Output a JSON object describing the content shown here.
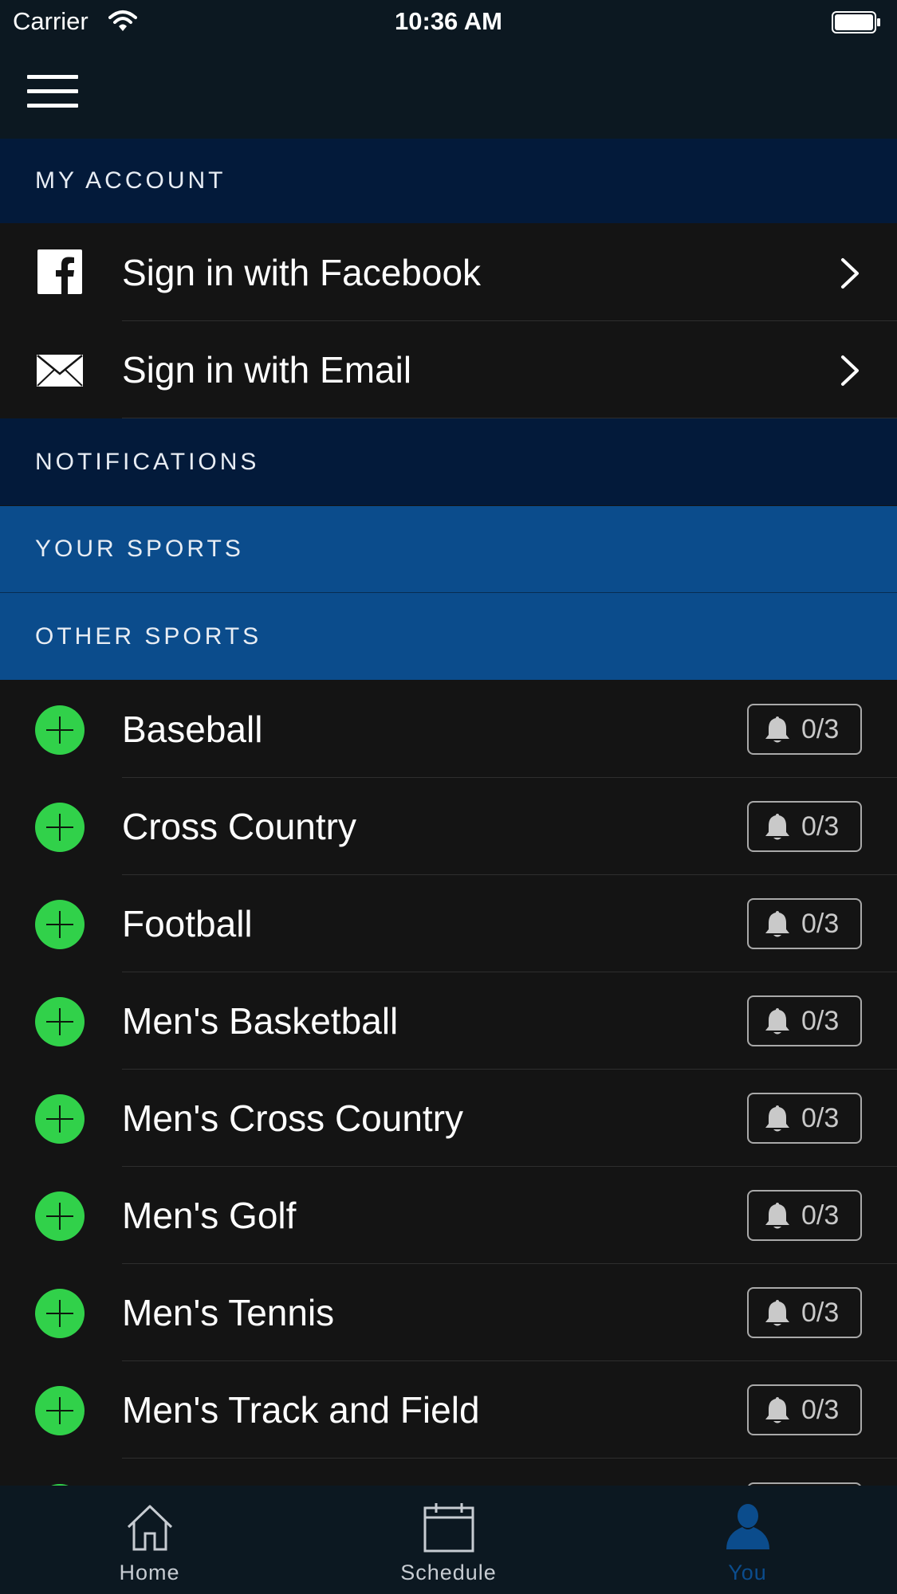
{
  "status_bar": {
    "carrier": "Carrier",
    "time": "10:36 AM"
  },
  "nav": {
    "menu_icon": "hamburger-menu-icon"
  },
  "sections": {
    "my_account": "MY ACCOUNT",
    "notifications": "NOTIFICATIONS",
    "your_sports": "YOUR SPORTS",
    "other_sports": "OTHER SPORTS"
  },
  "account_rows": [
    {
      "label": "Sign in with Facebook",
      "icon": "facebook-icon"
    },
    {
      "label": "Sign in with Email",
      "icon": "envelope-icon"
    }
  ],
  "sports": [
    {
      "name": "Baseball",
      "notifications": "0/3"
    },
    {
      "name": "Cross Country",
      "notifications": "0/3"
    },
    {
      "name": "Football",
      "notifications": "0/3"
    },
    {
      "name": "Men's Basketball",
      "notifications": "0/3"
    },
    {
      "name": "Men's Cross Country",
      "notifications": "0/3"
    },
    {
      "name": "Men's Golf",
      "notifications": "0/3"
    },
    {
      "name": "Men's Tennis",
      "notifications": "0/3"
    },
    {
      "name": "Men's Track and Field",
      "notifications": "0/3"
    }
  ],
  "tabs": [
    {
      "label": "Home",
      "icon": "home-icon"
    },
    {
      "label": "Schedule",
      "icon": "calendar-icon"
    },
    {
      "label": "You",
      "icon": "person-icon",
      "active": true
    }
  ],
  "colors": {
    "background": "#141414",
    "bar": "#0c1821",
    "section_dark": "#031a3a",
    "section_blue": "#0b4c8c",
    "add_green": "#31d14a",
    "active_tab": "#0b4c8c"
  }
}
